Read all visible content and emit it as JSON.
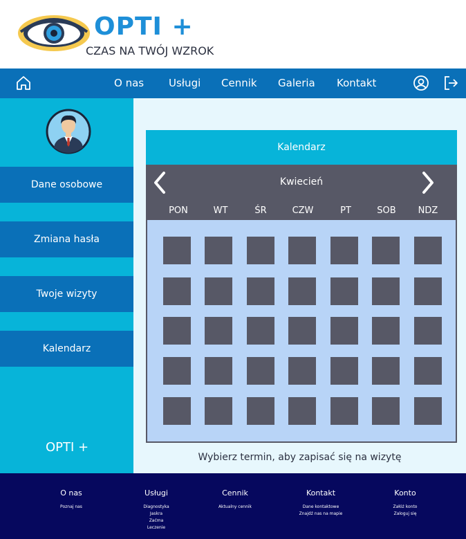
{
  "brand": {
    "name": "OPTI +",
    "tagline": "CZAS NA TWÓJ WZROK"
  },
  "nav": {
    "items": [
      "O nas",
      "Usługi",
      "Cennik",
      "Galeria",
      "Kontakt"
    ]
  },
  "sidebar": {
    "buttons": [
      "Dane osobowe",
      "Zmiana hasła",
      "Twoje wizyty",
      "Kalendarz"
    ],
    "brand": "OPTI +"
  },
  "calendar": {
    "title": "Kalendarz",
    "month": "Kwiecień",
    "days": [
      "PON",
      "WT",
      "ŚR",
      "CZW",
      "PT",
      "SOB",
      "NDZ"
    ],
    "hint": "Wybierz termin, aby zapisać się na wizytę"
  },
  "footer": {
    "columns": [
      {
        "title": "O nas",
        "links": [
          "Poznaj nas"
        ]
      },
      {
        "title": "Usługi",
        "links": [
          "Diagnostyka",
          "Jaskra",
          "Zaćma",
          "Leczenie"
        ]
      },
      {
        "title": "Cennik",
        "links": [
          "Aktualny cennik"
        ]
      },
      {
        "title": "Kontakt",
        "links": [
          "Dane kontaktowe",
          "Znajdź nas na mapie"
        ]
      },
      {
        "title": "Konto",
        "links": [
          "Załóż konto",
          "Zaloguj się"
        ]
      }
    ]
  },
  "colors": {
    "nav": "#0a70b8",
    "sidebar": "#07b4d9",
    "calendar_dark": "#575866",
    "calendar_grid": "#b8d4f7",
    "footer": "#06085e",
    "brand_blue": "#1e8fd8"
  },
  "icons": {
    "home": "home-icon",
    "user": "user-icon",
    "logout": "logout-icon",
    "prev": "chevron-left-icon",
    "next": "chevron-right-icon"
  }
}
